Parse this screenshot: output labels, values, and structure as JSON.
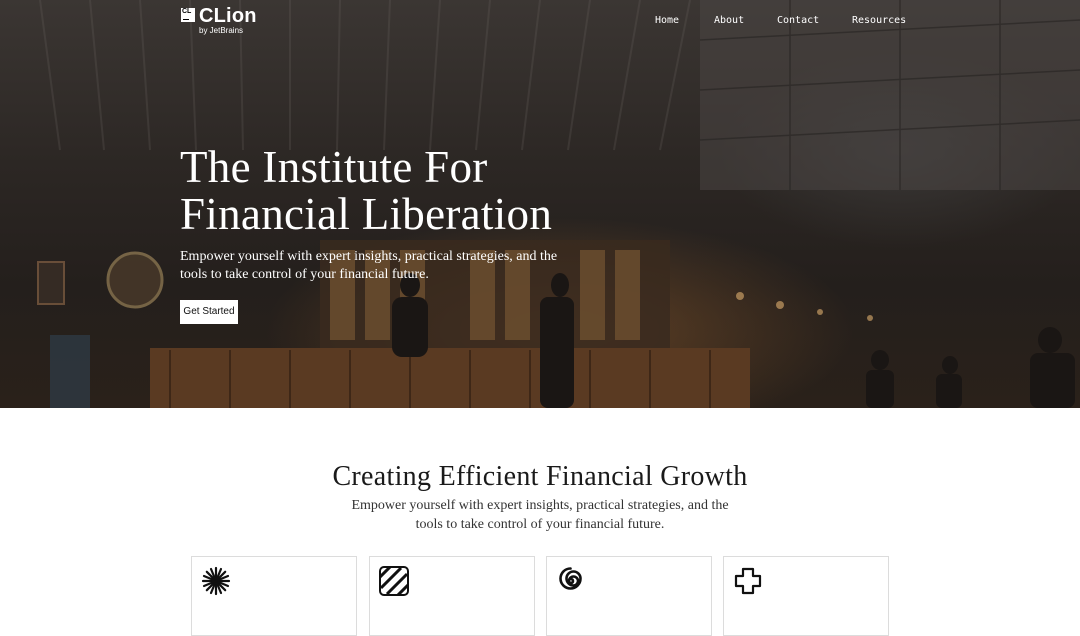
{
  "brand": {
    "name": "CLion",
    "badge": "CL",
    "byline": "by JetBrains"
  },
  "nav": [
    {
      "label": "Home"
    },
    {
      "label": "About"
    },
    {
      "label": "Contact"
    },
    {
      "label": "Resources"
    }
  ],
  "hero": {
    "title": "The Institute For Financial Liberation",
    "subtitle": "Empower yourself with expert insights, practical strategies, and the tools to take control of your financial future.",
    "cta_label": "Get Started",
    "background_image": "dim photo of a bar / café interior with shelves of bottles and patrons"
  },
  "section": {
    "title": "Creating Efficient Financial Growth",
    "subtitle": "Empower yourself with expert insights, practical strategies, and the tools to take control of your financial future."
  },
  "cards": [
    {
      "icon": "starburst-icon"
    },
    {
      "icon": "striped-square-icon"
    },
    {
      "icon": "spiral-icon"
    },
    {
      "icon": "cross-outline-icon"
    }
  ],
  "colors": {
    "hero_text": "#ffffff",
    "body_text": "#1a1a1a",
    "card_border": "#dcdcdc"
  }
}
